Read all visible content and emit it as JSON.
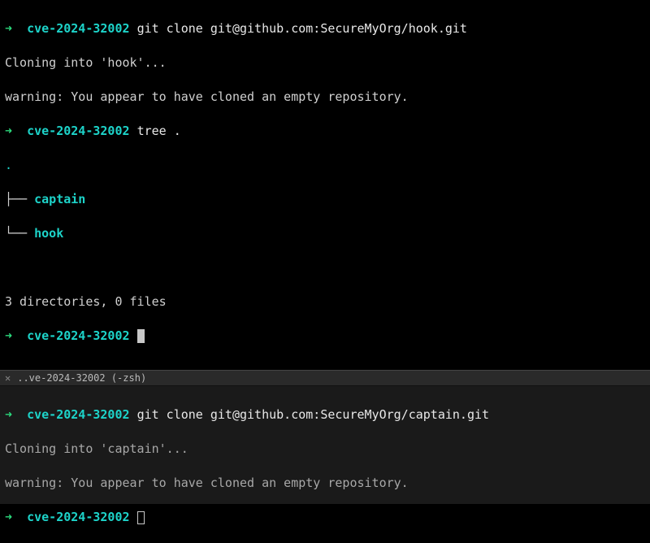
{
  "top": {
    "prompt1": {
      "arrow": "➜",
      "cwd": "cve-2024-32002",
      "cmd": "git clone git@github.com:SecureMyOrg/hook.git"
    },
    "out1": "Cloning into 'hook'...",
    "out2": "warning: You appear to have cloned an empty repository.",
    "prompt2": {
      "arrow": "➜",
      "cwd": "cve-2024-32002",
      "cmd": "tree ."
    },
    "tree": {
      "dot": ".",
      "branch1": "├── ",
      "name1": "captain",
      "branch2": "└── ",
      "name2": "hook"
    },
    "summary": "3 directories, 0 files",
    "prompt3": {
      "arrow": "➜",
      "cwd": "cve-2024-32002"
    }
  },
  "tab": {
    "close": "✕",
    "title": "..ve-2024-32002 (-zsh)"
  },
  "bottom": {
    "prompt1": {
      "arrow": "➜",
      "cwd": "cve-2024-32002",
      "cmd": "git clone git@github.com:SecureMyOrg/captain.git"
    },
    "out1": "Cloning into 'captain'...",
    "out2": "warning: You appear to have cloned an empty repository.",
    "prompt2": {
      "arrow": "➜",
      "cwd": "cve-2024-32002"
    }
  }
}
